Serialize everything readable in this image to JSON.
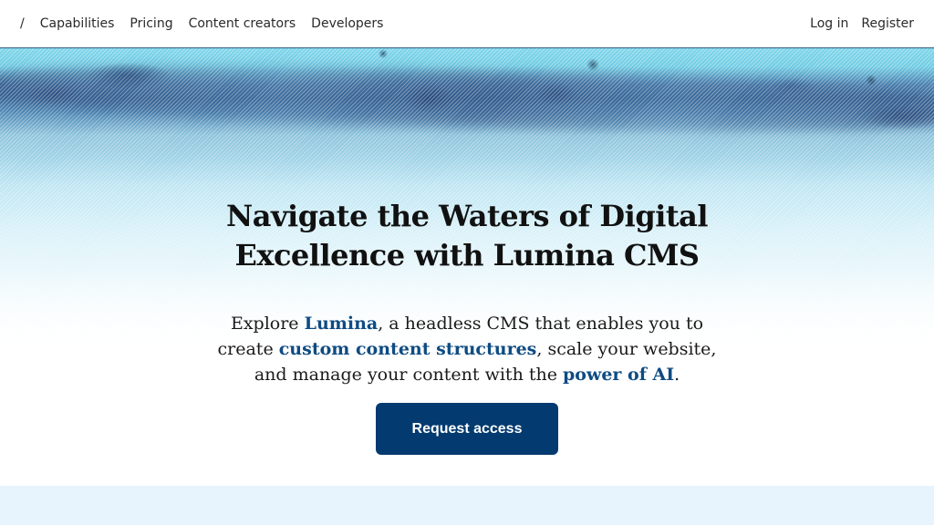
{
  "nav": {
    "home_label": "/",
    "links": [
      {
        "label": "Capabilities"
      },
      {
        "label": "Pricing"
      },
      {
        "label": "Content creators"
      },
      {
        "label": "Developers"
      }
    ],
    "auth": {
      "login_label": "Log in",
      "register_label": "Register"
    }
  },
  "hero": {
    "title_line1": "Navigate the Waters of Digital",
    "title_line2": "Excellence with Lumina CMS",
    "description": {
      "part1": "Explore ",
      "hl1": "Lumina",
      "part2": ", a headless CMS that enables you to",
      "part3": "create ",
      "hl2": "custom content structures",
      "part4": ", scale your website,",
      "part5": "and manage your content with the ",
      "hl3": "power of AI",
      "part6": "."
    },
    "cta_label": "Request access",
    "background_image": "water-ripple-image"
  },
  "colors": {
    "accent": "#033a6f",
    "highlight_text": "#0e4b82",
    "next_section_bg": "#e8f4fd"
  }
}
